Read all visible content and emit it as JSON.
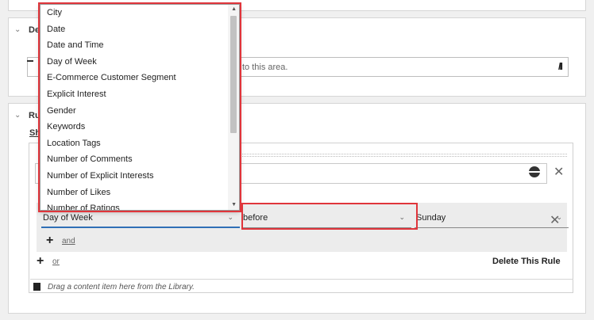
{
  "sections": {
    "definition_title": "De",
    "rules_title": "Ru"
  },
  "drop_area_text": "to this area.",
  "show_link": "Sh",
  "condition": {
    "field1": "Day of Week",
    "field2": "before",
    "field3": "Sunday",
    "and_label": "and"
  },
  "or_label": "or",
  "delete_rule_label": "Delete This Rule",
  "footer_drop_text": "Drag a content item here from the Library.",
  "dropdown_options": [
    "City",
    "Date",
    "Date and Time",
    "Day of Week",
    "E-Commerce Customer Segment",
    "Explicit Interest",
    "Gender",
    "Keywords",
    "Location Tags",
    "Number of Comments",
    "Number of Explicit Interests",
    "Number of Likes",
    "Number of Ratings"
  ],
  "colors": {
    "highlight": "#e0353b",
    "focus": "#2f6fb6"
  }
}
